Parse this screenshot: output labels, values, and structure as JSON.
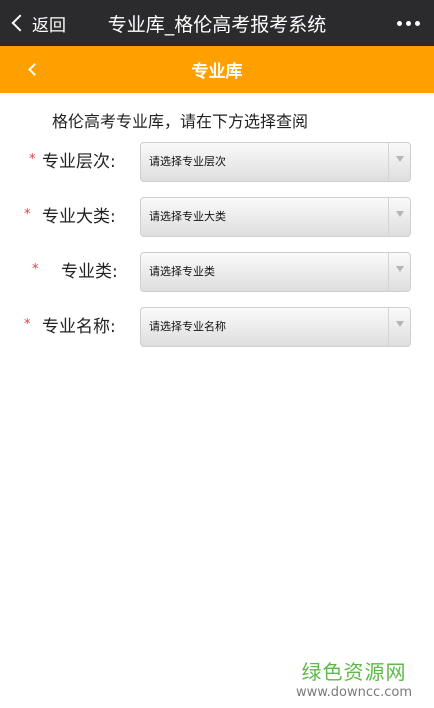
{
  "app_bar": {
    "back_label": "返回",
    "window_title": "专业库_格伦高考报考系统"
  },
  "nav": {
    "page_title": "专业库"
  },
  "intro": "格伦高考专业库，请在下方选择查阅",
  "form": {
    "required_mark": "*",
    "fields": [
      {
        "label": "专业层次:",
        "placeholder": "请选择专业层次"
      },
      {
        "label": "专业大类:",
        "placeholder": "请选择专业大类"
      },
      {
        "label": "专业类:",
        "placeholder": "请选择专业类"
      },
      {
        "label": "专业名称:",
        "placeholder": "请选择专业名称"
      }
    ]
  },
  "watermark": {
    "title": "绿色资源网",
    "url": "www.downcc.com"
  },
  "colors": {
    "top_bar": "#2b2b2d",
    "accent": "#ffa000",
    "required": "#e03c3c",
    "watermark": "#5fb94a"
  }
}
